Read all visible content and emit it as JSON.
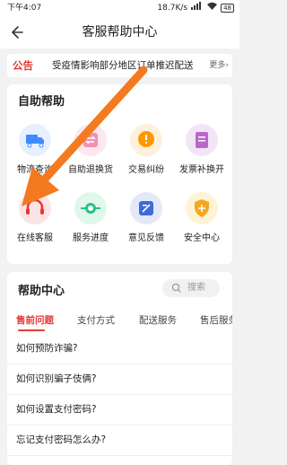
{
  "status_bar": {
    "time": "下午4:07",
    "speed": "18.7K/s",
    "battery": "48"
  },
  "header": {
    "title": "客服帮助中心"
  },
  "notice": {
    "tag": "公告",
    "text": "受疫情影响部分地区订单推迟配送",
    "more": "更多›"
  },
  "self_help": {
    "title": "自助帮助",
    "items": [
      {
        "label": "物流查询",
        "icon": "truck-icon",
        "color": "#3d8bff"
      },
      {
        "label": "自助退换货",
        "icon": "exchange-icon",
        "color": "#f06292"
      },
      {
        "label": "交易纠纷",
        "icon": "dispute-icon",
        "color": "#ff9800"
      },
      {
        "label": "发票补换开",
        "icon": "invoice-icon",
        "color": "#9c27b0"
      },
      {
        "label": "在线客服",
        "icon": "headset-icon",
        "color": "#e53935"
      },
      {
        "label": "服务进度",
        "icon": "progress-icon",
        "color": "#26c281"
      },
      {
        "label": "意见反馈",
        "icon": "feedback-icon",
        "color": "#3f6ad8"
      },
      {
        "label": "安全中心",
        "icon": "shield-icon",
        "color": "#f5a623"
      }
    ]
  },
  "help_center": {
    "title": "帮助中心",
    "search_placeholder": "搜索",
    "tabs": [
      "售前问题",
      "支付方式",
      "配送服务",
      "售后服务"
    ],
    "active_tab": 0,
    "faqs": [
      "如何预防诈骗?",
      "如何识别骗子伎俩?",
      "如何设置支付密码?",
      "忘记支付密码怎么办?"
    ]
  },
  "overlay": {
    "arrow_color": "#f47a20"
  }
}
